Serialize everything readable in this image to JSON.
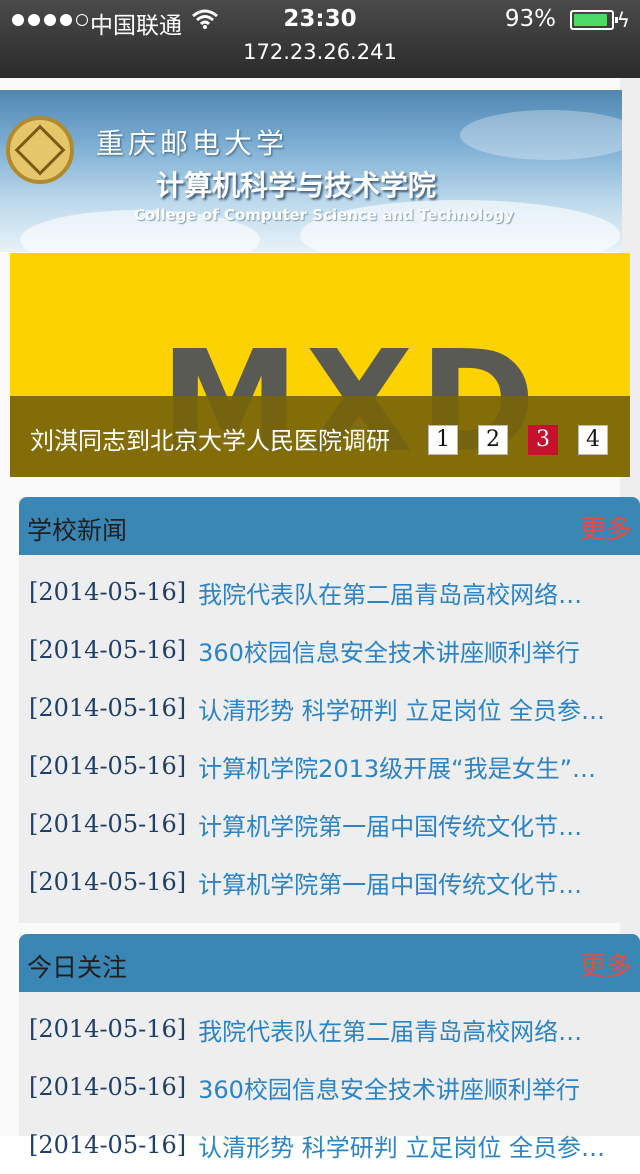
{
  "status_bar": {
    "carrier": "中国联通",
    "time": "23:30",
    "battery_percent": "93%",
    "battery_level": 0.93
  },
  "browser": {
    "url": "172.23.26.241"
  },
  "header": {
    "university_name": "重庆邮电大学",
    "college_name_cn": "计算机科学与技术学院",
    "college_name_en": "College of Computer Science and Technology"
  },
  "slider": {
    "image_text": "MXD",
    "caption": "刘淇同志到北京大学人民医院调研",
    "pages": [
      "1",
      "2",
      "3",
      "4"
    ],
    "active_page": "3",
    "colors": {
      "background": "#fcd300",
      "active_pager": "#c7102e"
    }
  },
  "school_news": {
    "title": "学校新闻",
    "more_label": "更多",
    "items": [
      {
        "date": "[2014-05-16]",
        "title": "我院代表队在第二届青岛高校网络…"
      },
      {
        "date": "[2014-05-16]",
        "title": "360校园信息安全技术讲座顺利举行"
      },
      {
        "date": "[2014-05-16]",
        "title": "认清形势 科学研判 立足岗位 全员参…"
      },
      {
        "date": "[2014-05-16]",
        "title": "计算机学院2013级开展“我是女生”…"
      },
      {
        "date": "[2014-05-16]",
        "title": "计算机学院第一届中国传统文化节…"
      },
      {
        "date": "[2014-05-16]",
        "title": "计算机学院第一届中国传统文化节…"
      }
    ]
  },
  "today_focus": {
    "title": "今日关注",
    "more_label": "更多",
    "items": [
      {
        "date": "[2014-05-16]",
        "title": "我院代表队在第二届青岛高校网络…"
      },
      {
        "date": "[2014-05-16]",
        "title": "360校园信息安全技术讲座顺利举行"
      },
      {
        "date": "[2014-05-16]",
        "title": "认清形势 科学研判 立足岗位 全员参…"
      }
    ]
  },
  "colors": {
    "panel_header": "#3a86b4",
    "more_link": "#e84c3d",
    "news_link": "#2b84c6"
  }
}
